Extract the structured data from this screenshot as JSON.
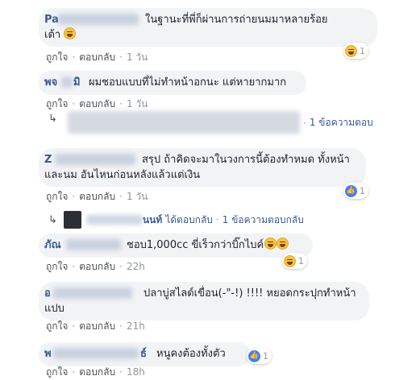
{
  "comments": [
    {
      "text_line1": "ในฐานะที่พี่ก็ผ่านการถ่ายนมมาหลายร้อย",
      "text_line2": "เต้า",
      "name_prefix": "Pa",
      "name_suffix": "",
      "like": "ถูกใจ",
      "reply": "ตอบกลับ",
      "time": "1 วัน",
      "reaction_count": "1"
    },
    {
      "text_line1": "ผมชอบแบบที่ไม่ทำหน้าอกนะ แต่หายากมาก",
      "name_prefix": "พจ",
      "name_suffix": "มิ",
      "like": "ถูกใจ",
      "reply": "ตอบกลับ",
      "time": "1 วัน",
      "reply_summary": "1 ข้อความตอบ"
    },
    {
      "text_line1": "สรุป ถ้าคิดจะมาในวงการนี้ต้องทำหมด ทั้งหน้า",
      "text_line2": "และนม อันไหนก่อนหลังแล้วแต่เงิน",
      "name_prefix": "Z",
      "like": "ถูกใจ",
      "reply": "ตอบกลับ",
      "time": "1 วัน",
      "reaction_count": "1",
      "reply_author_tail": "นนท์",
      "reply_action": "ได้ตอบกลับ",
      "reply_summary": "1 ข้อความตอบกลับ"
    },
    {
      "text_line1": "ชอบ1,000cc ขี่เร็วกว่าบิ๊กไบค์",
      "name_prefix": "ภัณ",
      "like": "ถูกใจ",
      "reply": "ตอบกลับ",
      "time": "22h",
      "reaction_count": "1"
    },
    {
      "text_line1": "ปลาบู่สไลด์เขื่อน(-\"-!) !!!! หยอดกระปุกทำหน้า",
      "text_line2": "แปบ",
      "name_prefix": "อ",
      "like": "ถูกใจ",
      "reply": "ตอบกลับ",
      "time": "21h"
    },
    {
      "text_line1": "หนูคงต้องทั้งตัว",
      "name_prefix": "พ",
      "name_suffix": "ธ์",
      "like": "ถูกใจ",
      "reply": "ตอบกลับ",
      "time": "18h",
      "reaction_count": "1"
    }
  ],
  "icons": {
    "reply_arrow": "↳",
    "like_icon": "👍"
  },
  "colors": {
    "bubble": "#f2f3f5",
    "link": "#385898",
    "meta": "#90949c"
  }
}
